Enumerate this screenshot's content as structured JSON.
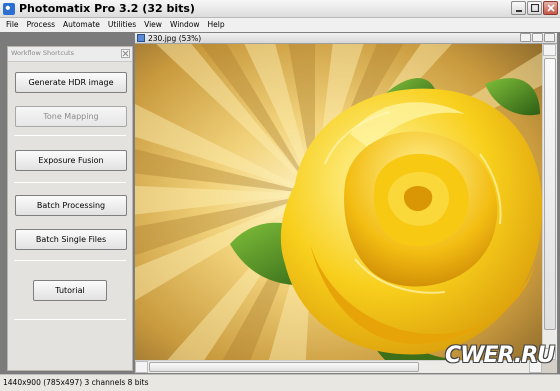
{
  "window": {
    "title": "Photomatix Pro 3.2 (32 bits)"
  },
  "menu": [
    "File",
    "Process",
    "Automate",
    "Utilities",
    "View",
    "Window",
    "Help"
  ],
  "panel": {
    "title": "Workflow Shortcuts",
    "buttons": {
      "generate_hdr": "Generate HDR image",
      "tone_mapping": "Tone Mapping",
      "exposure_fusion": "Exposure Fusion",
      "batch_processing": "Batch Processing",
      "batch_single": "Batch Single Files",
      "tutorial": "Tutorial"
    }
  },
  "image_window": {
    "title": "230.jpg (53%)"
  },
  "status": {
    "text": "1440x900 (785x497) 3 channels 8 bits"
  },
  "watermark": {
    "text": "CWER.RU"
  },
  "colors": {
    "rose": "#f6c615",
    "leaf": "#3f7d1e",
    "background_rays": "#d9a43a"
  }
}
